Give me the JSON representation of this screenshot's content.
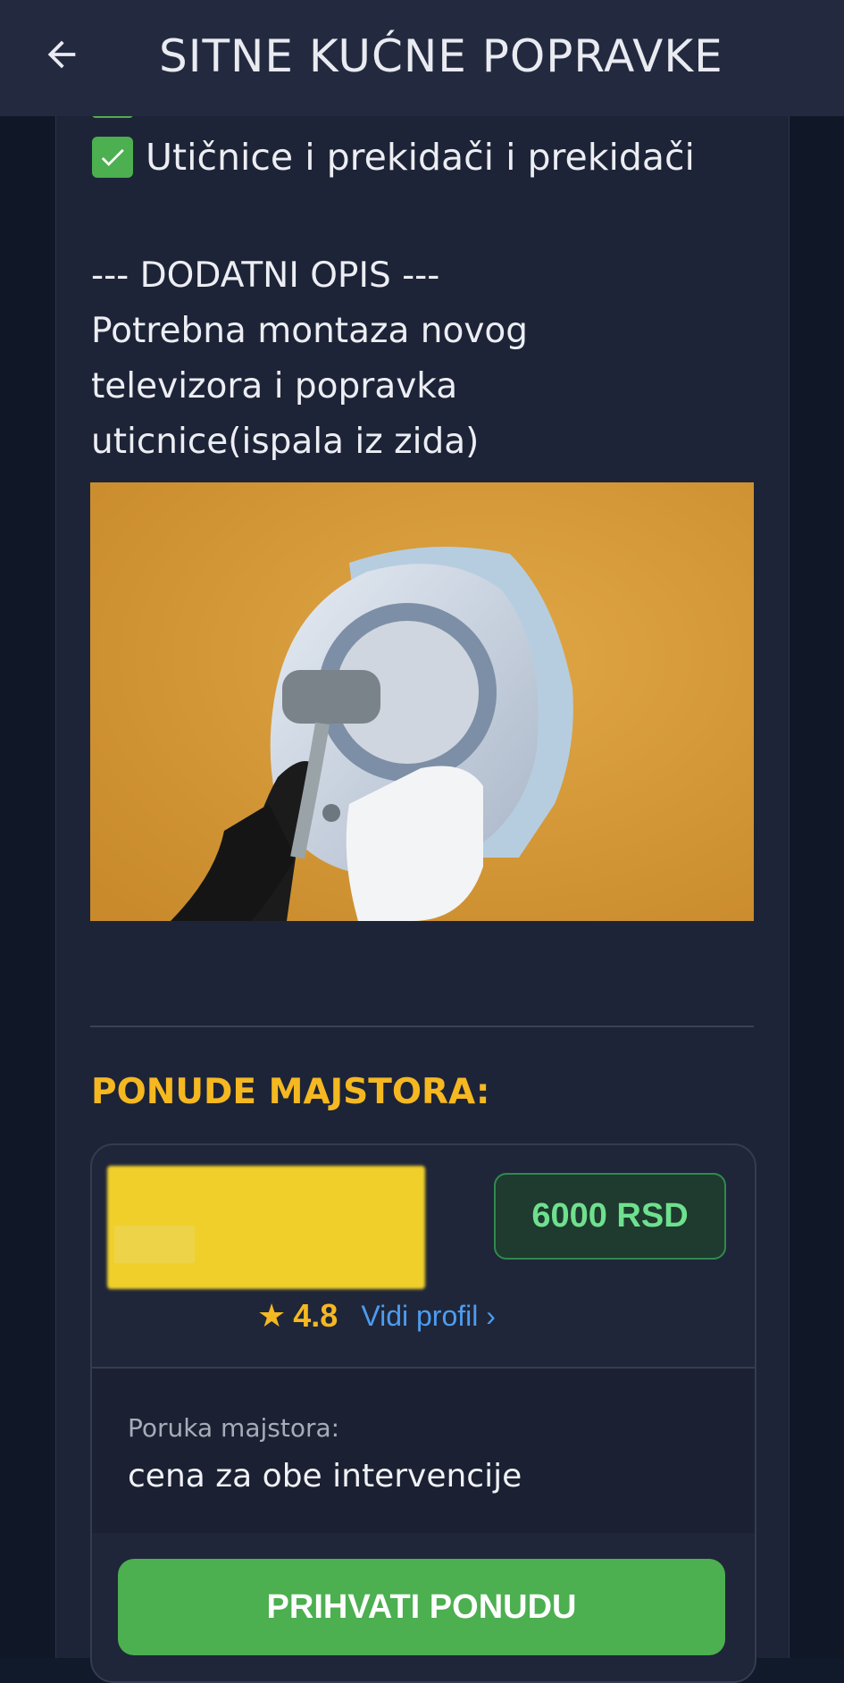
{
  "header": {
    "title": "SITNE KUĆNE POPRAVKE",
    "back_icon": "arrow-left-icon"
  },
  "services": {
    "visible_item": "Utičnice i prekidači i prekidači",
    "check_icon": "check-box-icon"
  },
  "description": {
    "heading": "--- DODATNI OPIS ---",
    "lines": [
      "Potrebna montaza novog",
      "televizora i popravka",
      "uticnice(ispala iz zida)"
    ]
  },
  "offers": {
    "heading": "PONUDE MAJSTORA:",
    "items": [
      {
        "price": "6000 RSD",
        "rating": "4.8",
        "profile_link": "Vidi profil ›",
        "message_label": "Poruka majstora:",
        "message": "cena za obe intervencije",
        "accept_label": "PRIHVATI PONUDU"
      }
    ]
  },
  "colors": {
    "accent_yellow": "#f5b821",
    "accent_green": "#4caf50",
    "link_blue": "#4d9cf0",
    "panel": "#1e2437",
    "appbar": "#232a40"
  }
}
